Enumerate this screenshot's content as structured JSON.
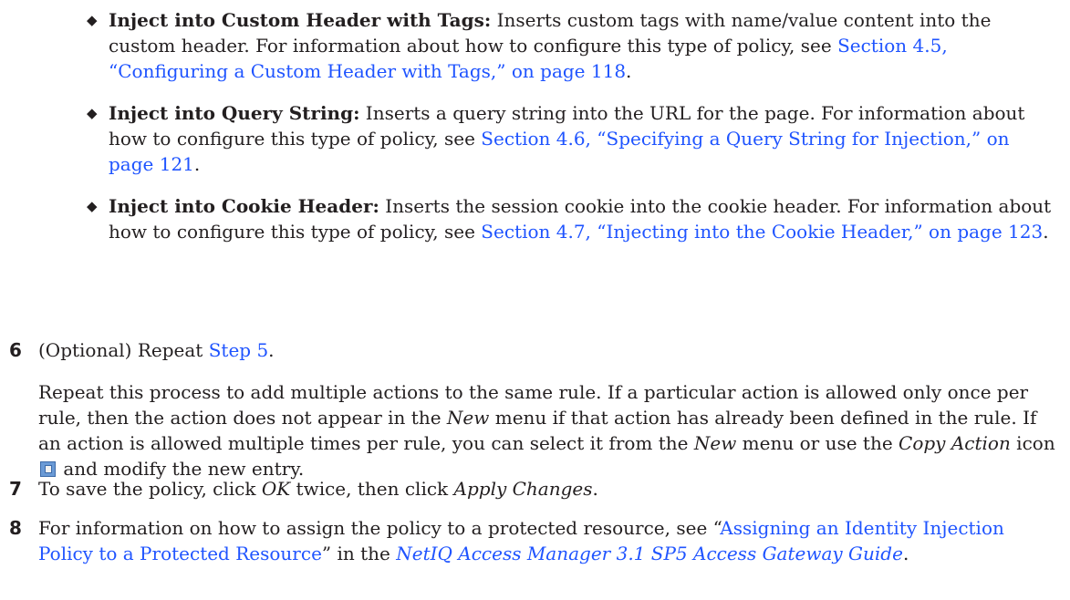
{
  "bullets": [
    {
      "title": "Inject into Custom Header with Tags:",
      "text": " Inserts custom tags with name/value content into the custom header. For information about how to configure this type of policy, see ",
      "link": "Section 4.5, “Configuring a Custom Header with Tags,” on page 118",
      "tail": "."
    },
    {
      "title": "Inject into Query String:",
      "text": " Inserts a query string into the URL for the page. For information about how to configure this type of policy, see ",
      "link": "Section 4.6, “Specifying a Query String for Injection,” on page 121",
      "tail": "."
    },
    {
      "title": "Inject into Cookie Header:",
      "text": " Inserts the session cookie into the cookie header. For information about how to configure this type of policy, see ",
      "link": "Section 4.7, “Injecting into the Cookie Header,” on page 123",
      "tail": "."
    }
  ],
  "steps": {
    "s6": {
      "num": "6",
      "text": "(Optional) Repeat ",
      "link": "Step 5",
      "tail": ".",
      "para_a": "Repeat this process to add multiple actions to the same rule. If a particular action is allowed only once per rule, then the action does not appear in the ",
      "new1": "New",
      "para_b": " menu if that action has already been defined in the rule. If an action is allowed multiple times per rule, you can select it from the ",
      "new2": "New",
      "para_c": " menu or use the ",
      "copy_action": "Copy Action",
      "para_d": " icon ",
      "para_e": " and modify the new entry."
    },
    "s7": {
      "num": "7",
      "text": "To save the policy, click ",
      "ok": "OK",
      "mid": " twice, then click ",
      "apply": "Apply Changes",
      "tail": "."
    },
    "s8": {
      "num": "8",
      "text": "For information on how to assign the policy to a protected resource, see “",
      "link": "Assigning an Identity Injection Policy to a Protected Resource",
      "mid": "” in the ",
      "guide": "NetIQ Access Manager 3.1 SP5 Access Gateway Guide",
      "tail": "."
    }
  },
  "icons": {
    "bullet": "diamond-bullet-icon",
    "copy_action": "copy-action-icon"
  },
  "colors": {
    "link": "#1f54ff",
    "text": "#231f20"
  }
}
